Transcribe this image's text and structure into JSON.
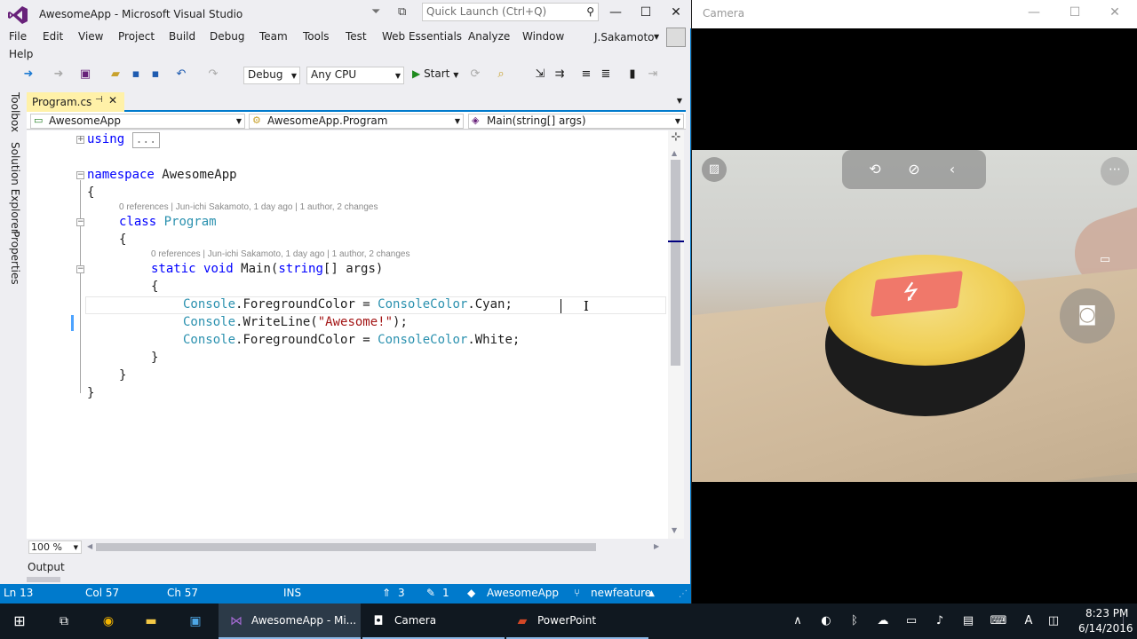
{
  "vs": {
    "title": "AwesomeApp - Microsoft Visual Studio",
    "quick_launch_placeholder": "Quick Launch (Ctrl+Q)",
    "menu": [
      "File",
      "Edit",
      "View",
      "Project",
      "Build",
      "Debug",
      "Team",
      "Tools",
      "Test",
      "Web Essentials",
      "Analyze",
      "Window",
      "Help"
    ],
    "account": "J.Sakamoto",
    "toolbar": {
      "config": "Debug",
      "platform": "Any CPU",
      "start": "Start"
    },
    "side_tabs": [
      "Toolbox",
      "Solution Explorer",
      "Properties"
    ],
    "tab": {
      "label": "Program.cs"
    },
    "nav": {
      "project": "AwesomeApp",
      "type": "AwesomeApp.Program",
      "member": "Main(string[] args)"
    },
    "code": {
      "using_kw": "using",
      "using_collapsed": "...",
      "namespace_kw": "namespace",
      "namespace_name": "AwesomeApp",
      "open_brace": "{",
      "close_brace": "}",
      "lens": "0 references | Jun-ichi Sakamoto, 1 day ago | 1 author, 2 changes",
      "class_kw": "class",
      "class_name": "Program",
      "static_kw": "static",
      "void_kw": "void",
      "main_sig_a": "Main(",
      "string_kw": "string",
      "main_sig_b": "[] args)",
      "console": "Console",
      "consolecolor": "ConsoleColor",
      "fg_prop": ".ForegroundColor = ",
      "cyan": ".Cyan;",
      "writeline": ".WriteLine(",
      "awesome_str": "\"Awesome!\"",
      "writeline_end": ");",
      "white": ".White;"
    },
    "zoom": "100 %",
    "output_label": "Output",
    "status": {
      "ln": "Ln 13",
      "col": "Col 57",
      "ch": "Ch 57",
      "mode": "INS",
      "pushes": "3",
      "edits": "1",
      "repo": "AwesomeApp",
      "branch": "newfeature"
    }
  },
  "camera": {
    "title": "Camera"
  },
  "taskbar": {
    "apps": [
      {
        "label": "AwesomeApp - Mi..."
      },
      {
        "label": "Camera"
      },
      {
        "label": "PowerPoint"
      }
    ],
    "time": "8:23 PM",
    "date": "6/14/2016",
    "ime": "A"
  },
  "colors": {
    "accent": "#007acc",
    "keyword": "#0000ff",
    "type": "#2b91af",
    "string": "#a31515",
    "tab_active": "#fff1a8"
  }
}
